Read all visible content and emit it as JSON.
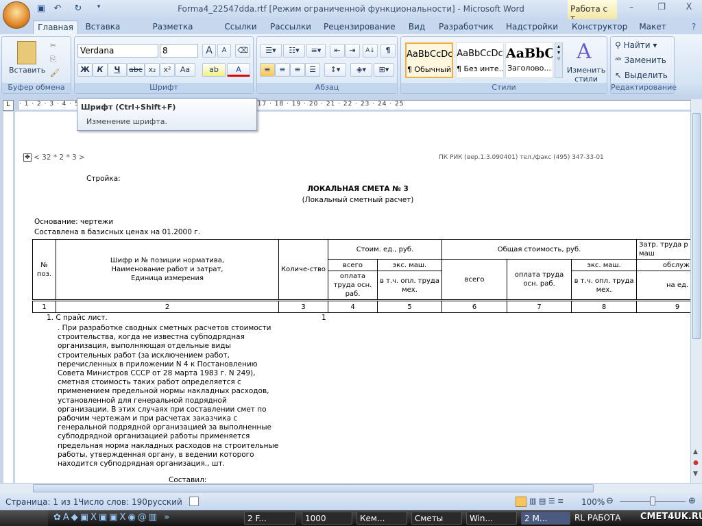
{
  "window": {
    "title": "Forma4_22547dda.rtf [Режим ограниченной функциональности] - Microsoft Word",
    "context_tab": "Работа с т...",
    "minimize": "–",
    "restore": "❐",
    "close": "X"
  },
  "tabs": [
    "Главная",
    "Вставка",
    "Разметка страницы",
    "Ссылки",
    "Рассылки",
    "Рецензирование",
    "Вид",
    "Разработчик",
    "Надстройки",
    "Конструктор",
    "Макет"
  ],
  "ribbon": {
    "clipboard": {
      "label": "Буфер обмена",
      "paste": "Вставить"
    },
    "font": {
      "label": "Шрифт",
      "font_name": "Verdana",
      "font_size": "8",
      "bold": "Ж",
      "italic": "К",
      "underline": "Ч",
      "strike": "abc",
      "sub": "x₂",
      "sup": "x²",
      "case": "Aa",
      "grow": "A",
      "shrink": "A",
      "color": "A"
    },
    "paragraph": {
      "label": "Абзац",
      "pilcrow": "¶",
      "sort": "А↓"
    },
    "styles": {
      "label": "Стили",
      "items": [
        {
          "preview": "AaBbCcDc",
          "name": "¶ Обычный"
        },
        {
          "preview": "AaBbCcDc",
          "name": "¶ Без инте..."
        },
        {
          "preview": "AaBbC",
          "name": "Заголово..."
        }
      ],
      "change": "Изменить стили"
    },
    "editing": {
      "label": "Редактирование",
      "find": "Найти",
      "replace": "Заменить",
      "select": "Выделить"
    }
  },
  "ruler": {
    "marks": "· 1 · 2 · 3 · 4 · 5 · 6 · 7 · 8 · 9 · 10 · 11 · 12 · 13 · 14 · 15 · 16 · 17 · 18 · 19 · 20 · 21 · 22 · 23 · 24 · 25"
  },
  "tooltip": {
    "title": "Шрифт (Ctrl+Shift+F)",
    "text": "Изменение шрифта."
  },
  "document": {
    "page_ref": "< 32 * 2 * 3 >",
    "header_right": "ПК РИК (вер.1.3.090401) тел./факс (495) 347-33-01",
    "stroika": "Стройка:",
    "heading": "ЛОКАЛЬНАЯ СМЕТА № 3",
    "subheading": "(Локальный сметный расчет)",
    "osnovanie": "Основание: чертежи",
    "sostavlena": "Составлена в базисных ценах на 01.2000 г.",
    "table": {
      "h_pos": "№ поз.",
      "h_shifr": "Шифр и № позиции норматива, Наименование работ и затрат, Единица измерения",
      "h_qty": "Количе-ство",
      "h_unit_cost": "Стоим. ед., руб.",
      "h_total": "Общая стоимость, руб.",
      "h_labor": "Затр. труда р обсл. маш",
      "h_vsego": "всего",
      "h_eks": "экс. маш.",
      "h_oplata": "оплата труда осн. раб.",
      "h_vtch": "в т.ч. опл. труда мех.",
      "h_vsego2": "всего",
      "h_oplata2": "оплата труда осн. раб.",
      "h_eks2": "экс. маш.",
      "h_vtch2": "в т.ч. опл. труда мех.",
      "h_obsl": "обслуж.",
      "h_na_ed": "на ед.",
      "col_numbers": [
        "1",
        "2",
        "3",
        "4",
        "5",
        "6",
        "7",
        "8",
        "9"
      ]
    },
    "item_title": "1. С прайс лист.",
    "item_qty": "1",
    "item_text": [
      ". При разработке сводных сметных расчетов стоимости",
      "строительства, когда не известна субподрядная",
      "организация, выполняющая отдельные виды",
      "строительных работ (за исключением работ,",
      "перечисленных в приложении N 4 к Постановлению",
      "Совета Министров СССР от 28 марта 1983 г. N 249),",
      "сметная стоимость таких работ определяется с",
      "применением предельной нормы накладных расходов,",
      "установленной для генеральной подрядной",
      "организации. В этих случаях при составлении смет по",
      "рабочим чертежам и при расчетах заказчика с",
      "генеральной подрядной организацией за выполненные",
      "субподрядной организацией работы применяется",
      "предельная норма накладных расходов на строительные",
      "работы, утвержденная органу, в ведении которого",
      "находится субподрядная организация., шт."
    ],
    "sostavil": "Составил:"
  },
  "status": {
    "page": "Страница: 1 из 1",
    "words": "Число слов: 190",
    "lang": "русский",
    "zoom": "100%"
  },
  "taskbar": {
    "items": [
      "2 F...",
      "1000",
      "Кем...",
      "Сметы",
      "Win...",
      "2 M...",
      "RL  РАБОТА"
    ],
    "watermark": "СМЕТ4UK.RU"
  }
}
